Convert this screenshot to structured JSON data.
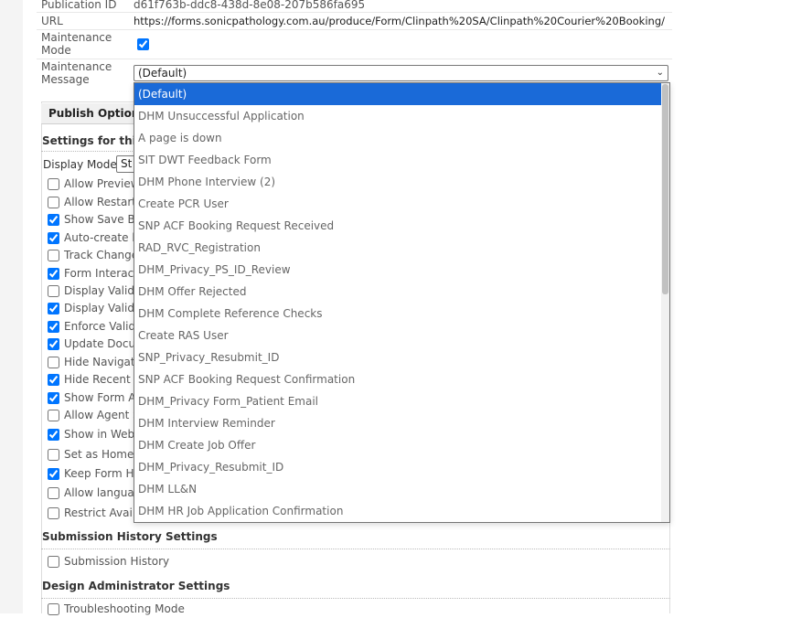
{
  "properties": {
    "publication_id": {
      "label": "Publication ID",
      "value": "d61f763b-ddc8-438d-8e08-207b586fa695"
    },
    "url": {
      "label": "URL",
      "value": "https://forms.sonicpathology.com.au/produce/Form/Clinpath%20SA/Clinpath%20Courier%20Booking/"
    },
    "maintenance_mode": {
      "label_line1": "Maintenance",
      "label_line2": "Mode",
      "checked": true
    },
    "maintenance_message": {
      "label_line1": "Maintenance",
      "label_line2": "Message",
      "selected": "(Default)"
    }
  },
  "publish_tab": {
    "label": "Publish Options"
  },
  "settings_section": {
    "title": "Settings for this p"
  },
  "display_mode": {
    "label": "Display Mode",
    "value": "St"
  },
  "options": [
    {
      "label": "Allow Preview",
      "checked": false
    },
    {
      "label": "Allow Restart",
      "checked": false
    },
    {
      "label": "Show Save Bu",
      "checked": true
    },
    {
      "label": "Auto-create l",
      "checked": true
    },
    {
      "label": "Track Change",
      "checked": false
    },
    {
      "label": "Form Interact",
      "checked": true
    },
    {
      "label": "Display Valida",
      "checked": false
    },
    {
      "label": "Display Valida",
      "checked": true
    },
    {
      "label": "Enforce Valid",
      "checked": true
    },
    {
      "label": "Update Docu",
      "checked": true
    },
    {
      "label": "Hide Navigati",
      "checked": false
    },
    {
      "label": "Hide Recent F",
      "checked": true
    },
    {
      "label": "Show Form A",
      "checked": true
    },
    {
      "label": "Allow Agent S",
      "checked": false
    },
    {
      "label": "Show in Web",
      "checked": true
    },
    {
      "label": "Set as Home",
      "checked": false
    },
    {
      "label": "Keep Form Hi",
      "checked": true
    },
    {
      "label": "Allow languag",
      "checked": false
    },
    {
      "label": "Restrict Avail",
      "checked": false
    }
  ],
  "submission_history": {
    "title": "Submission History Settings",
    "option_label": "Submission History",
    "checked": false
  },
  "design_admin": {
    "title": "Design Administrator Settings",
    "option_label": "Troubleshooting Mode",
    "checked": false
  },
  "dropdown_items": [
    "(Default)",
    "DHM Unsuccessful Application",
    "A page is down",
    "SIT DWT Feedback Form",
    "DHM Phone Interview (2)",
    "Create PCR User",
    "SNP ACF Booking Request Received",
    "RAD_RVC_Registration",
    "DHM_Privacy_PS_ID_Review",
    "DHM Offer Rejected",
    "DHM Complete Reference Checks",
    "Create RAS User",
    "SNP_Privacy_Resubmit_ID",
    "SNP ACF Booking Request Confirmation",
    "DHM_Privacy Form_Patient Email",
    "DHM Interview Reminder",
    "DHM Create Job Offer",
    "DHM_Privacy_Resubmit_ID",
    "DHM LL&N",
    "DHM HR Job Application Confirmation"
  ],
  "colors": {
    "selection": "#1a6ad8",
    "checkbox": "#0075ff"
  }
}
